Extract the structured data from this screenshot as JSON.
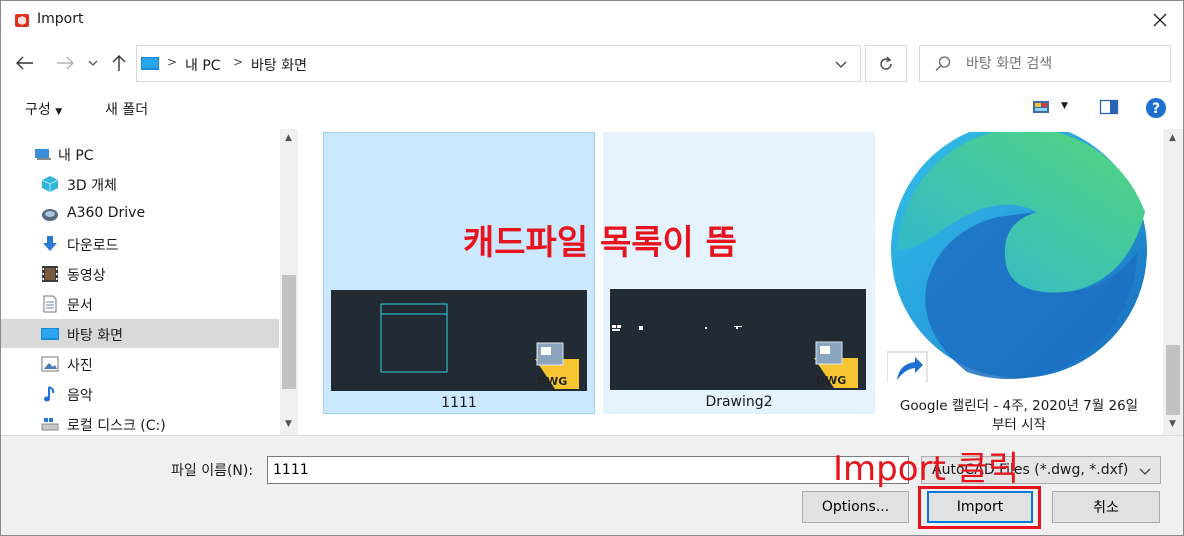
{
  "window": {
    "title": "Import"
  },
  "address": {
    "crumbs": [
      "내 PC",
      "바탕 화면"
    ]
  },
  "search": {
    "placeholder": "바탕 화면 검색"
  },
  "toolbar": {
    "organize": "구성",
    "new_folder": "새 폴더"
  },
  "sidebar": {
    "items": [
      {
        "label": "내 PC",
        "icon": "pc-icon"
      },
      {
        "label": "3D 개체",
        "icon": "3d-objects-icon"
      },
      {
        "label": "A360 Drive",
        "icon": "a360-drive-icon"
      },
      {
        "label": "다운로드",
        "icon": "download-icon"
      },
      {
        "label": "동영상",
        "icon": "video-icon"
      },
      {
        "label": "문서",
        "icon": "document-icon"
      },
      {
        "label": "바탕 화면",
        "icon": "desktop-icon",
        "selected": true
      },
      {
        "label": "사진",
        "icon": "pictures-icon"
      },
      {
        "label": "음악",
        "icon": "music-icon"
      },
      {
        "label": "로컬 디스크 (C:)",
        "icon": "local-disk-icon"
      }
    ]
  },
  "files": [
    {
      "name": "1111",
      "type": "DWG",
      "selected": true
    },
    {
      "name": "Drawing2",
      "type": "DWG"
    },
    {
      "name_line1": "Google 캘린더 - 4주, 2020년 7월 26일",
      "name_line2": "부터 시작",
      "icon": "edge-shortcut-icon"
    }
  ],
  "annotations": {
    "file_list": "캐드파일 목록이 뜸",
    "import_click": "Import 클릭"
  },
  "bottom": {
    "filename_label": "파일 이름(N):",
    "filename_value": "1111",
    "filetype_value": "AutoCAD Files (*.dwg, *.dxf)",
    "options_button": "Options...",
    "import_button": "Import",
    "cancel_button": "취소"
  },
  "colors": {
    "accent": "#0078d7",
    "annotation": "#e8141d",
    "selection": "#cce8ff"
  }
}
